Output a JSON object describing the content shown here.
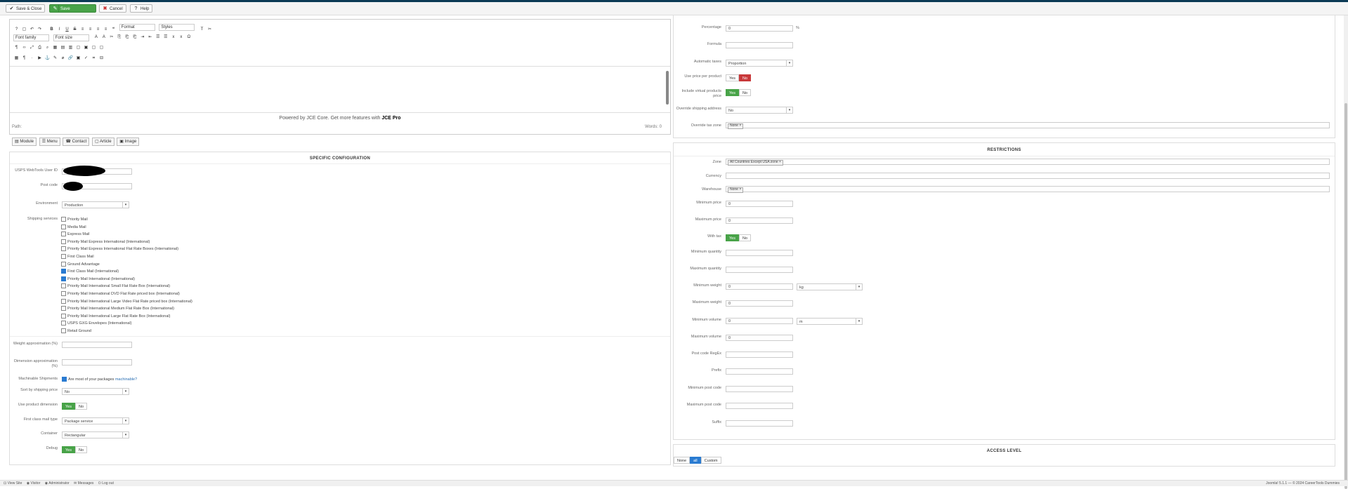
{
  "toolbar": {
    "save_close": "Save & Close",
    "save": "Save",
    "cancel": "Cancel",
    "help": "Help"
  },
  "editor": {
    "font_family": "Font family",
    "font_size": "Font size",
    "format": "Format",
    "styles": "Styles",
    "powered_prefix": "Powered by JCE Core. Get more features with ",
    "powered_brand": "JCE Pro",
    "path": "Path:",
    "words": "Words: 0",
    "buttons": [
      "Module",
      "Menu",
      "Contact",
      "Article",
      "Image"
    ]
  },
  "specific": {
    "title": "SPECIFIC CONFIGURATION",
    "usps_user_label": "USPS WebTools User ID",
    "post_code_label": "Post code",
    "environment_label": "Environment",
    "environment_value": "Production",
    "shipping_services_label": "Shipping services",
    "services": [
      {
        "label": "Priority Mail",
        "checked": false
      },
      {
        "label": "Media Mail",
        "checked": false
      },
      {
        "label": "Express Mail",
        "checked": false
      },
      {
        "label": "Priority Mail Express International (International)",
        "checked": false
      },
      {
        "label": "Priority Mail Express International Flat Rate Boxes (International)",
        "checked": false
      },
      {
        "label": "First Class Mail",
        "checked": false
      },
      {
        "label": "Ground Advantage",
        "checked": false
      },
      {
        "label": "First Class Mail (International)",
        "checked": true
      },
      {
        "label": "Priority Mail International (International)",
        "checked": true
      },
      {
        "label": "Priority Mail International Small Flat Rate Box (International)",
        "checked": false
      },
      {
        "label": "Priority Mail International DVD Flat Rate priced box (International)",
        "checked": false
      },
      {
        "label": "Priority Mail International Large Video Flat Rate priced box (International)",
        "checked": false
      },
      {
        "label": "Priority Mail International Medium Flat Rate Box (International)",
        "checked": false
      },
      {
        "label": "Priority Mail International Large Flat Rate Box (International)",
        "checked": false
      },
      {
        "label": "USPS GXG Envelopes (International)",
        "checked": false
      },
      {
        "label": "Retail Ground",
        "checked": false
      }
    ],
    "weight_approx_label": "Weight approximation (%)",
    "dimension_approx_label": "Dimension approximation (%)",
    "machinable_label": "Machinable Shipments",
    "machinable_text": "Are most of your packages ",
    "machinable_link": "machinable?",
    "sort_label": "Sort by shipping price",
    "sort_value": "No",
    "use_dim_label": "Use product dimension",
    "first_class_label": "First class mail type",
    "first_class_value": "Package service",
    "container_label": "Container",
    "container_value": "Rectangular",
    "debug_label": "Debug",
    "yes": "Yes",
    "no": "No"
  },
  "pricing": {
    "percentage_label": "Percentage",
    "percentage_value": "0",
    "percent_sign": "%",
    "formula_label": "Formula",
    "auto_taxes_label": "Automatic taxes",
    "auto_taxes_value": "Proportion",
    "price_per_product_label": "Use price per product",
    "include_virtual_label": "Include virtual products price",
    "override_shipping_label": "Override shipping address",
    "override_shipping_value": "No",
    "override_tax_zone_label": "Override tax zone",
    "override_tax_zone_chip": "None",
    "yes": "Yes",
    "no": "No"
  },
  "restrictions": {
    "title": "RESTRICTIONS",
    "zone_label": "Zone",
    "zone_chip": "All Countries Except USA zone",
    "currency_label": "Currency",
    "warehouse_label": "Warehouse",
    "warehouse_chip": "None",
    "min_price_label": "Minimum price",
    "min_price_value": "0",
    "max_price_label": "Maximum price",
    "max_price_value": "0",
    "with_tax_label": "With tax",
    "min_qty_label": "Minimum quantity",
    "max_qty_label": "Maximum quantity",
    "min_weight_label": "Minimum weight",
    "min_weight_value": "0",
    "weight_unit": "kg",
    "max_weight_label": "Maximum weight",
    "max_weight_value": "0",
    "min_volume_label": "Minimum volume",
    "min_volume_value": "0",
    "volume_unit": "m",
    "max_volume_label": "Maximum volume",
    "max_volume_value": "0",
    "post_code_regex_label": "Post code RegEx",
    "prefix_label": "Prefix",
    "min_post_code_label": "Minimum post code",
    "max_post_code_label": "Maximum post code",
    "suffix_label": "Suffix",
    "yes": "Yes",
    "no": "No"
  },
  "access": {
    "title": "ACCESS LEVEL",
    "none": "None",
    "all": "all",
    "custom": "Custom"
  },
  "statusbar": {
    "items": [
      "View Site",
      "Visitor",
      "Administrator",
      "Messages",
      "Log out"
    ],
    "version": "Joomla! 5.1.1 — © 2024 CareerTools Dummies"
  }
}
